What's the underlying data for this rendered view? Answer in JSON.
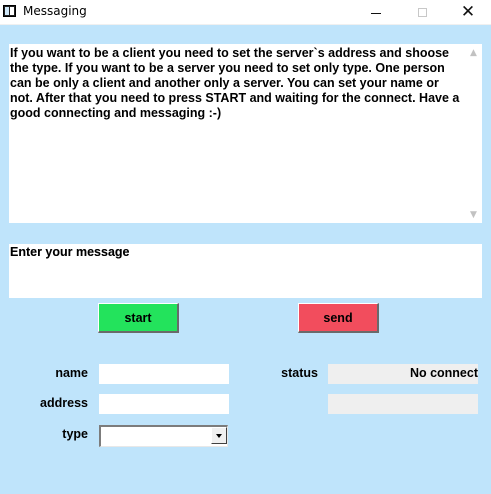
{
  "window": {
    "title": "Messaging",
    "icon": "window-app-icon",
    "controls": {
      "minimize": "minimize-icon",
      "maximize": "maximize-icon",
      "close": "close-icon"
    }
  },
  "info": {
    "text": "If you want to be a client you need to set the server`s address and shoose the type. If you want to be a server you need to set only type. One person can be only a client and another only a server. You can set your name or not. After that you need to press START and waiting for the connect. Have a good connecting and messaging :-)"
  },
  "message": {
    "placeholder": "Enter your message"
  },
  "buttons": {
    "start": "start",
    "send": "send"
  },
  "form": {
    "name_label": "name",
    "name_value": "",
    "address_label": "address",
    "address_value": "",
    "type_label": "type",
    "type_value": "",
    "status_label": "status",
    "status_value": "No connect",
    "status_secondary_value": ""
  },
  "colors": {
    "background": "#bfe4fb",
    "start_button": "#23e35c",
    "send_button": "#f24d5d",
    "status_field": "#efefef"
  }
}
